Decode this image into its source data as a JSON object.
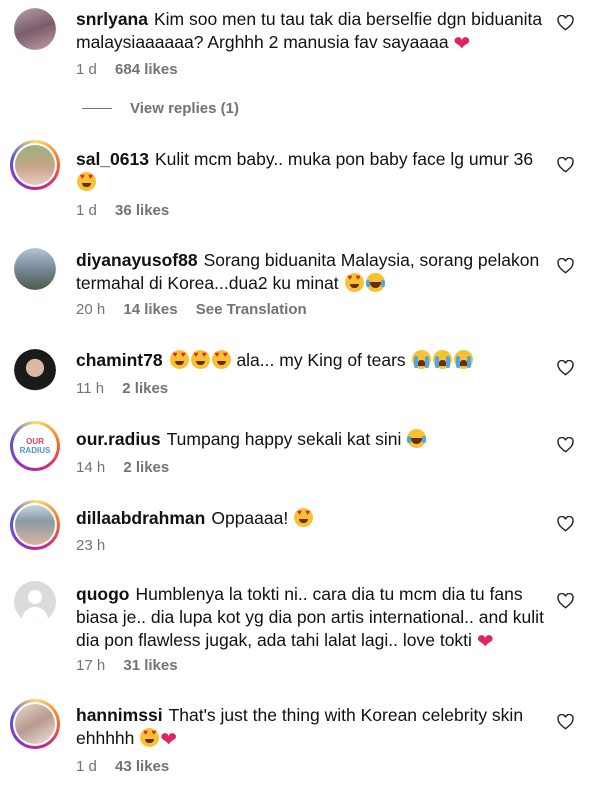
{
  "comments": [
    {
      "username": "snrlyana",
      "text": "Kim soo men tu tau tak dia berselfie dgn biduanita malaysiaaaaaa? Arghhh 2 manusia fav sayaaaa",
      "time": "1 d",
      "likes": "684 likes",
      "view_replies": "View replies (1)"
    },
    {
      "username": "sal_0613",
      "text": "Kulit mcm baby.. muka pon baby face lg umur 36",
      "time": "1 d",
      "likes": "36 likes"
    },
    {
      "username": "diyanayusof88",
      "text": "Sorang biduanita Malaysia, sorang pelakon termahal di Korea...dua2 ku minat",
      "time": "20 h",
      "likes": "14 likes",
      "see_translation": "See Translation"
    },
    {
      "username": "chamint78",
      "text": "ala... my King of tears",
      "time": "11 h",
      "likes": "2 likes"
    },
    {
      "username": "our.radius",
      "text": "Tumpang happy sekali kat sini",
      "time": "14 h",
      "likes": "2 likes",
      "avatar_text_1": "OUR",
      "avatar_text_2": "RADIUS"
    },
    {
      "username": "dillaabdrahman",
      "text": "Oppaaaa!",
      "time": "23 h"
    },
    {
      "username": "quogo",
      "text": "Humblenya la tokti ni.. cara dia tu mcm dia tu fans biasa je.. dia lupa kot yg dia pon artis international.. and kulit dia pon flawless jugak, ada tahi lalat lagi.. love tokti",
      "time": "17 h",
      "likes": "31 likes"
    },
    {
      "username": "hannimssi",
      "text": "That's just the thing with Korean celebrity skin ehhhhh",
      "time": "1 d",
      "likes": "43 likes"
    }
  ],
  "icons": {
    "like": "heart-outline-icon",
    "heart_emoji": "red-heart",
    "heart_eyes_emoji": "smiling-face-with-heart-eyes",
    "cry_emoji": "loudly-crying-face",
    "laugh_emoji": "face-with-tears-of-joy"
  },
  "colors": {
    "meta_grey": "#737373",
    "heart_red": "#e0245e",
    "emoji_yellow": "#f6c230"
  }
}
